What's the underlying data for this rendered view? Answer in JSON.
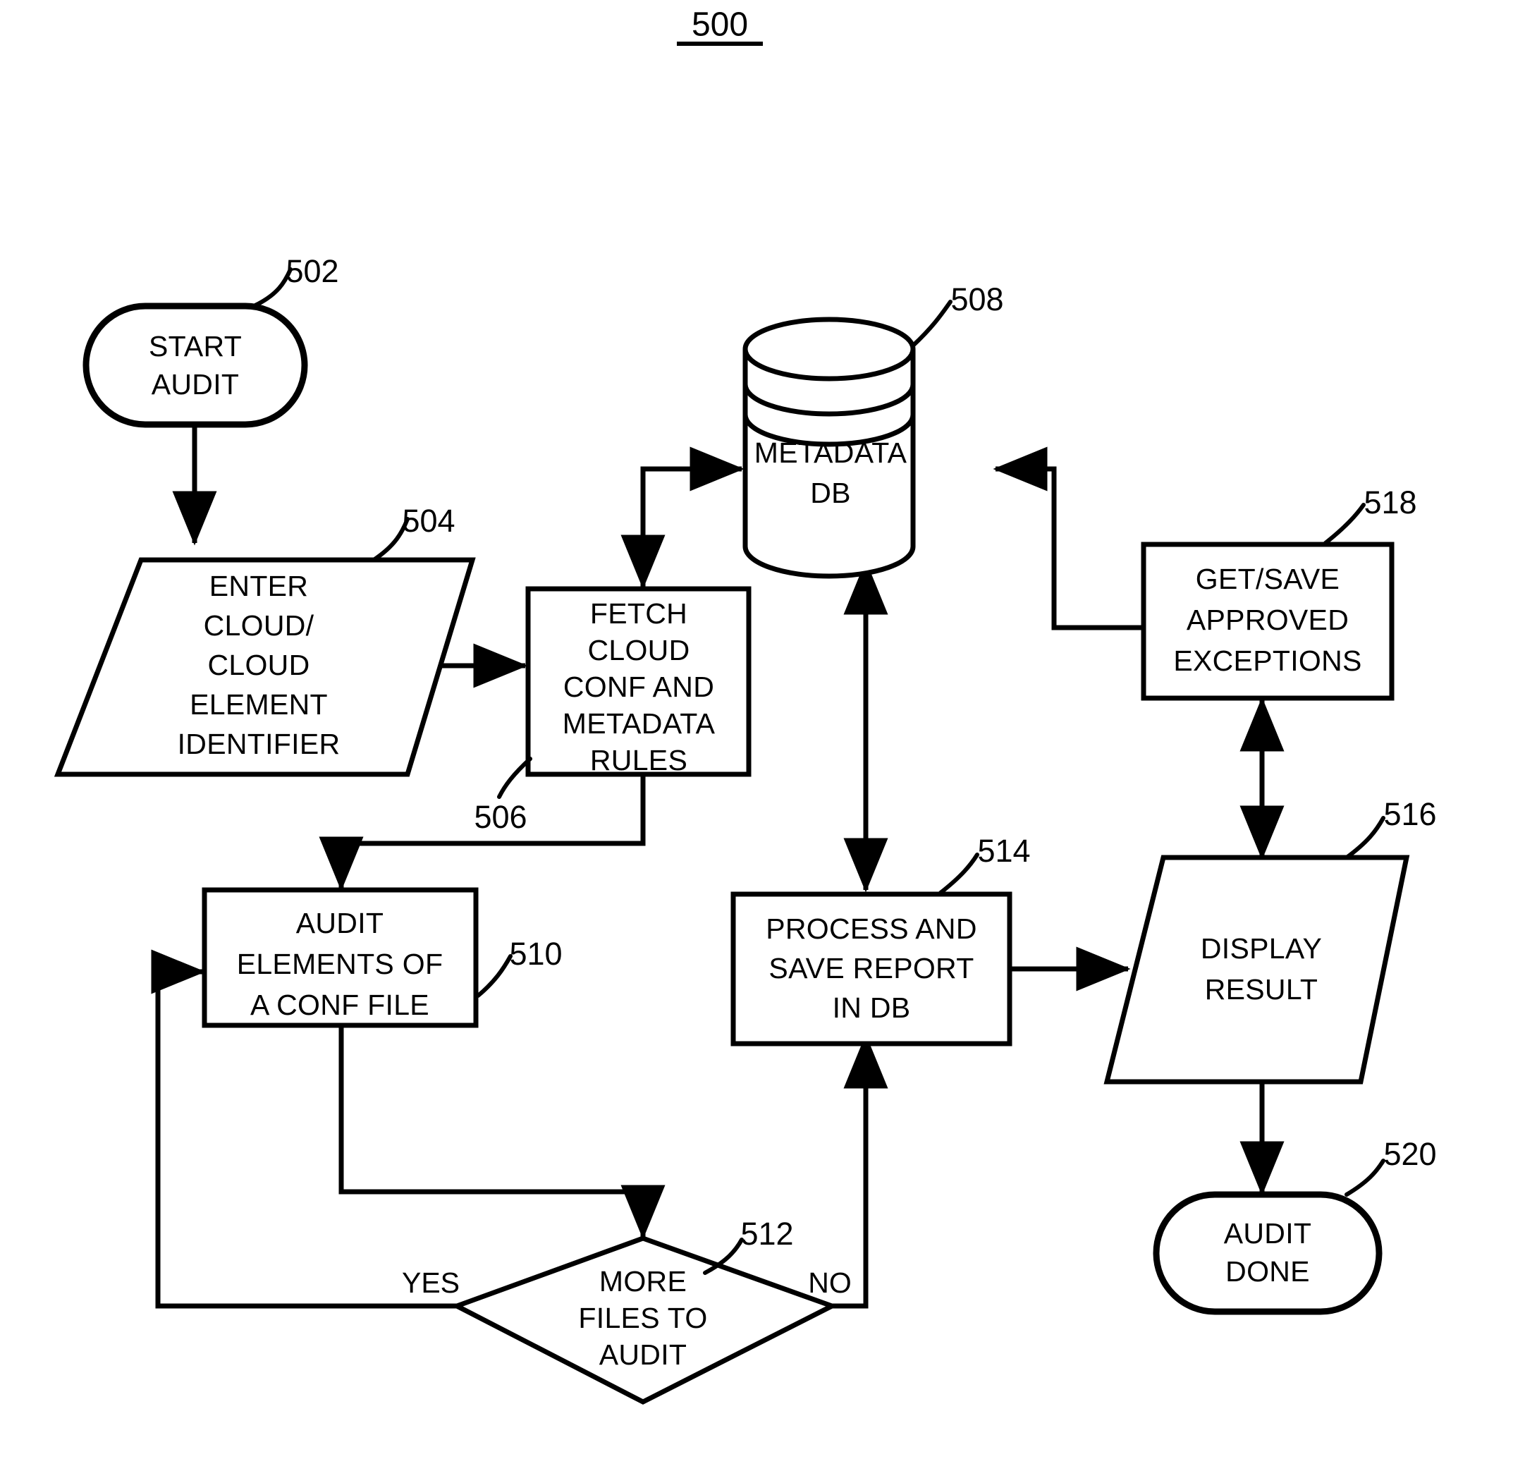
{
  "figure": {
    "number": "500",
    "type": "flowchart",
    "background_color": "#ffffff",
    "line_color": "#000000"
  },
  "nodes": {
    "start": {
      "ref": "502",
      "shape": "terminator",
      "lines": [
        "START",
        "AUDIT"
      ]
    },
    "enter_identifier": {
      "ref": "504",
      "shape": "parallelogram",
      "lines": [
        "ENTER",
        "CLOUD/",
        "CLOUD",
        "ELEMENT",
        "IDENTIFIER"
      ]
    },
    "fetch_conf": {
      "ref": "506",
      "shape": "process",
      "lines": [
        "FETCH",
        "CLOUD",
        "CONF AND",
        "METADATA",
        "RULES"
      ]
    },
    "metadata_db": {
      "ref": "508",
      "shape": "database",
      "lines": [
        "METADATA",
        "DB"
      ]
    },
    "audit_elements": {
      "ref": "510",
      "shape": "process",
      "lines": [
        "AUDIT",
        "ELEMENTS OF",
        "A CONF FILE"
      ]
    },
    "more_files": {
      "ref": "512",
      "shape": "decision",
      "lines": [
        "MORE",
        "FILES TO",
        "AUDIT"
      ],
      "branch_yes": "YES",
      "branch_no": "NO"
    },
    "process_report": {
      "ref": "514",
      "shape": "process",
      "lines": [
        "PROCESS AND",
        "SAVE REPORT",
        "IN DB"
      ]
    },
    "display_result": {
      "ref": "516",
      "shape": "parallelogram",
      "lines": [
        "DISPLAY",
        "RESULT"
      ]
    },
    "get_save_exceptions": {
      "ref": "518",
      "shape": "process",
      "lines": [
        "GET/SAVE",
        "APPROVED",
        "EXCEPTIONS"
      ]
    },
    "audit_done": {
      "ref": "520",
      "shape": "terminator",
      "lines": [
        "AUDIT",
        "DONE"
      ]
    }
  },
  "chart_data": {
    "type": "diagram",
    "title": "500",
    "nodes": [
      {
        "id": "502",
        "label": "START AUDIT",
        "shape": "terminator"
      },
      {
        "id": "504",
        "label": "ENTER CLOUD/ CLOUD ELEMENT IDENTIFIER",
        "shape": "parallelogram"
      },
      {
        "id": "506",
        "label": "FETCH CLOUD CONF AND METADATA RULES",
        "shape": "process"
      },
      {
        "id": "508",
        "label": "METADATA DB",
        "shape": "database"
      },
      {
        "id": "510",
        "label": "AUDIT ELEMENTS OF A CONF FILE",
        "shape": "process"
      },
      {
        "id": "512",
        "label": "MORE FILES TO AUDIT",
        "shape": "decision"
      },
      {
        "id": "514",
        "label": "PROCESS AND SAVE REPORT IN DB",
        "shape": "process"
      },
      {
        "id": "516",
        "label": "DISPLAY RESULT",
        "shape": "parallelogram"
      },
      {
        "id": "518",
        "label": "GET/SAVE APPROVED EXCEPTIONS",
        "shape": "process"
      },
      {
        "id": "520",
        "label": "AUDIT DONE",
        "shape": "terminator"
      }
    ],
    "edges": [
      {
        "from": "502",
        "to": "504",
        "label": ""
      },
      {
        "from": "504",
        "to": "506",
        "label": ""
      },
      {
        "from": "506",
        "to": "508",
        "label": ""
      },
      {
        "from": "508",
        "to": "506",
        "label": ""
      },
      {
        "from": "506",
        "to": "510",
        "label": ""
      },
      {
        "from": "510",
        "to": "512",
        "label": ""
      },
      {
        "from": "512",
        "to": "510",
        "label": "YES"
      },
      {
        "from": "512",
        "to": "514",
        "label": "NO"
      },
      {
        "from": "514",
        "to": "508",
        "label": "",
        "bidirectional": true
      },
      {
        "from": "514",
        "to": "516",
        "label": ""
      },
      {
        "from": "518",
        "to": "508",
        "label": ""
      },
      {
        "from": "518",
        "to": "516",
        "label": "",
        "bidirectional": true
      },
      {
        "from": "516",
        "to": "520",
        "label": ""
      }
    ]
  }
}
